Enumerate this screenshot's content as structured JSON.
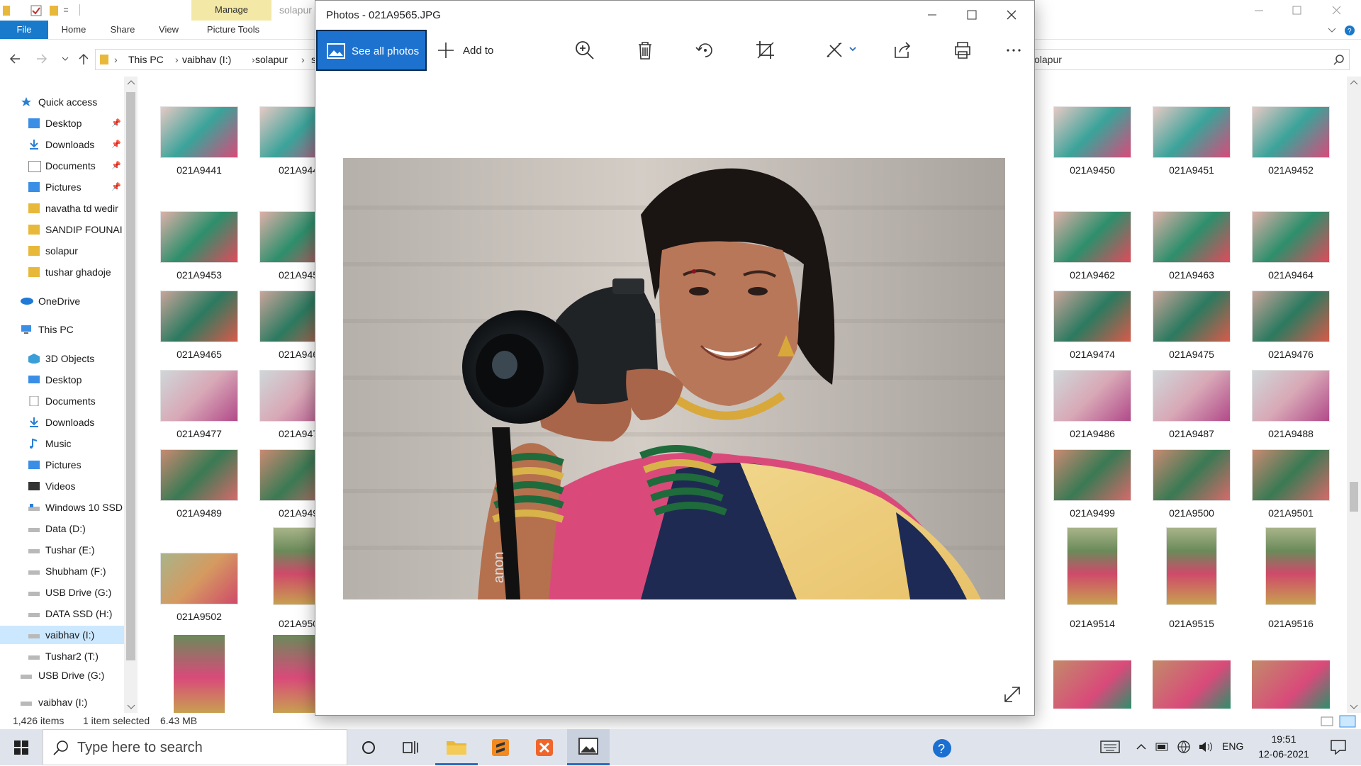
{
  "explorer": {
    "tabs": {
      "file": "File",
      "home": "Home",
      "share": "Share",
      "view": "View",
      "picture_tools": "Picture Tools",
      "manage": "Manage",
      "context_title": "solapur"
    },
    "address": {
      "parts": [
        "This PC",
        "vaibhav  (I:)",
        "solapur",
        "s"
      ]
    },
    "search": {
      "placeholder": "olapur"
    },
    "nav": {
      "quick_access": "Quick access",
      "quick_items": [
        "Desktop",
        "Downloads",
        "Documents",
        "Pictures",
        "navatha td wedir",
        "SANDIP FOUNAI",
        "solapur",
        "tushar ghadoje"
      ],
      "onedrive": "OneDrive",
      "this_pc": "This PC",
      "pc_items": [
        "3D Objects",
        "Desktop",
        "Documents",
        "Downloads",
        "Music",
        "Pictures",
        "Videos",
        "Windows 10 SSD",
        "Data (D:)",
        "Tushar (E:)",
        "Shubham (F:)",
        "USB Drive (G:)",
        "DATA SSD (H:)",
        "vaibhav  (I:)",
        "Tushar2 (T:)"
      ],
      "usb": "USB Drive (G:)",
      "vaibhav": "vaibhav  (I:)"
    },
    "grid_left": [
      {
        "name": "021A9441",
        "col": 0,
        "row": 0
      },
      {
        "name": "021A944",
        "col": 1,
        "row": 0
      },
      {
        "name": "021A9453",
        "col": 0,
        "row": 1
      },
      {
        "name": "021A945",
        "col": 1,
        "row": 1
      },
      {
        "name": "021A9465",
        "col": 0,
        "row": 2
      },
      {
        "name": "021A946",
        "col": 1,
        "row": 2
      },
      {
        "name": "021A9477",
        "col": 0,
        "row": 3
      },
      {
        "name": "021A947",
        "col": 1,
        "row": 3
      },
      {
        "name": "021A9489",
        "col": 0,
        "row": 4
      },
      {
        "name": "021A949",
        "col": 1,
        "row": 4
      },
      {
        "name": "021A9502",
        "col": 0,
        "row": 5
      },
      {
        "name": "021A950",
        "col": 1,
        "row": 5
      }
    ],
    "grid_right": [
      {
        "name": "021A9450",
        "row": 0
      },
      {
        "name": "021A9451",
        "row": 0
      },
      {
        "name": "021A9452",
        "row": 0
      },
      {
        "name": "021A9462",
        "row": 1
      },
      {
        "name": "021A9463",
        "row": 1
      },
      {
        "name": "021A9464",
        "row": 1
      },
      {
        "name": "021A9474",
        "row": 2
      },
      {
        "name": "021A9475",
        "row": 2
      },
      {
        "name": "021A9476",
        "row": 2
      },
      {
        "name": "021A9486",
        "row": 3
      },
      {
        "name": "021A9487",
        "row": 3
      },
      {
        "name": "021A9488",
        "row": 3
      },
      {
        "name": "021A9499",
        "row": 4
      },
      {
        "name": "021A9500",
        "row": 4
      },
      {
        "name": "021A9501",
        "row": 4
      },
      {
        "name": "021A9514",
        "row": 5
      },
      {
        "name": "021A9515",
        "row": 5
      },
      {
        "name": "021A9516",
        "row": 5
      }
    ],
    "status": {
      "items": "1,426 items",
      "selected": "1 item selected",
      "size": "6.43 MB"
    }
  },
  "photos": {
    "title": "Photos - 021A9565.JPG",
    "see_all": "See all photos",
    "add_to": "Add to",
    "camera_text": "anon"
  },
  "taskbar": {
    "search_placeholder": "Type here to search",
    "lang": "ENG",
    "time": "19:51",
    "date": "12-06-2021"
  },
  "colors": {
    "accent": "#1d72d0",
    "file_tab": "#1979ca",
    "manage_tab": "#f3e8a6",
    "taskbar": "#dfe4ec"
  }
}
